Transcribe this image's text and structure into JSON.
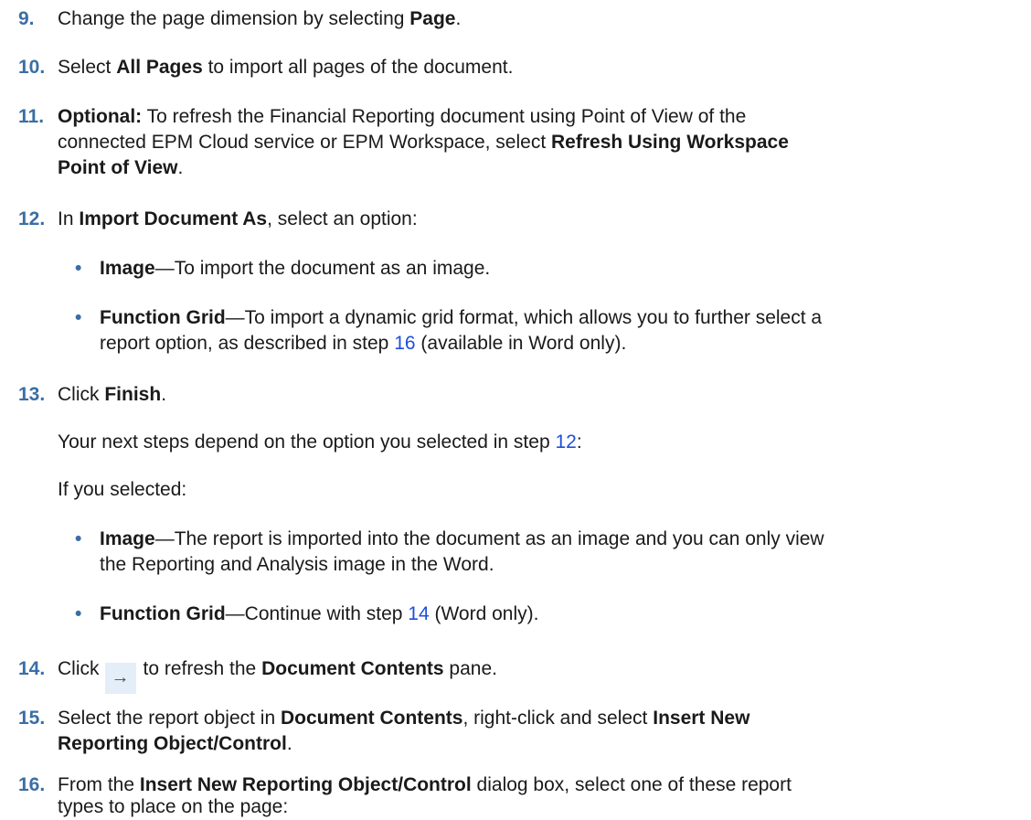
{
  "steps": {
    "s9": {
      "num": "9.",
      "t1": "Change the page dimension by selecting ",
      "b1": "Page",
      "t2": "."
    },
    "s10": {
      "num": "10.",
      "b1": "All Pages",
      "t0": "Select ",
      "t2": " to import all pages of the document."
    },
    "s11": {
      "num": "11.",
      "b1": "Optional:",
      "l1": " To refresh the Financial Reporting document using Point of View of the",
      "l2a": "connected EPM Cloud service or EPM Workspace, select ",
      "l2b": "Refresh Using Workspace",
      "l3b": "Point of View",
      "l3": "."
    },
    "s12": {
      "num": "12.",
      "t0": "In ",
      "b1": "Import Document As",
      "t2": ", select an option:",
      "opt1": {
        "b": "Image",
        "t": "—To import the document as an image."
      },
      "opt2": {
        "b": "Function Grid",
        "t": "—To import a dynamic grid format, which allows you to further select a",
        "l2a": "report option, as described in step ",
        "link": "16",
        "l2b": " (available in Word only)."
      }
    },
    "s13": {
      "num": "13.",
      "t0": "Click ",
      "b1": "Finish",
      "t2": ".",
      "p1a": "Your next steps depend on the option you selected in step ",
      "p1link": "12",
      "p1b": ":",
      "p2": "If you selected:",
      "opt1": {
        "b": "Image",
        "t": "—The report is imported into the document as an image and you can only view",
        "l2": "the Reporting and Analysis image in the Word."
      },
      "opt2": {
        "b": "Function Grid",
        "ta": "—Continue with step ",
        "link": "14",
        "tb": " (Word only)."
      }
    },
    "s14": {
      "num": "14.",
      "t0": "Click",
      "icon": "arrow-right-icon",
      "t1": "to refresh the ",
      "b1": "Document Contents",
      "t2": " pane."
    },
    "s15": {
      "num": "15.",
      "t0": "Select the report object in ",
      "b1": "Document Contents",
      "t1": ", right-click and select ",
      "b2": "Insert New",
      "b3": "Reporting Object/Control",
      "t2": "."
    },
    "s16": {
      "num": "16.",
      "t0": "From the ",
      "b1": "Insert New Reporting Object/Control",
      "t1": " dialog box, select one of these report",
      "l2": "types to place on the page:"
    }
  },
  "colors": {
    "number": "#3a6ea5",
    "link": "#1f4fd8",
    "icon_bg": "#e3eef8"
  }
}
